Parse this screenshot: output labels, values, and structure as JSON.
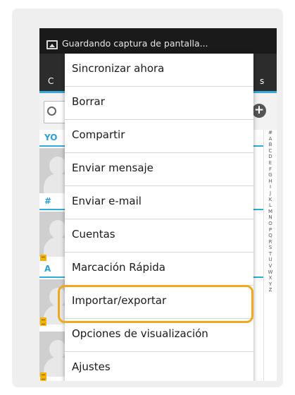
{
  "notification": {
    "text": "Guardando captura de pantalla..."
  },
  "tabs": {
    "left_partial": "C",
    "right_partial": "s"
  },
  "list": {
    "sections": [
      "YO",
      "#",
      "A"
    ]
  },
  "alphabet_index": [
    "#",
    "A",
    "B",
    "C",
    "D",
    "E",
    "F",
    "G",
    "H",
    "I",
    "J",
    "K",
    "L",
    "M",
    "N",
    "O",
    "P",
    "Q",
    "R",
    "S",
    "T",
    "U",
    "V",
    "W",
    "X",
    "Y",
    "Z"
  ],
  "menu": {
    "items": [
      "Sincronizar ahora",
      "Borrar",
      "Compartir",
      "Enviar mensaje",
      "Enviar e-mail",
      "Cuentas",
      "Marcación Rápida",
      "Importar/exportar",
      "Opciones de visualización",
      "Ajustes"
    ],
    "highlighted_item": "Importar/exportar"
  },
  "colors": {
    "accent": "#36a9d8",
    "highlight": "#f0a820",
    "sim_badge": "#f2b200"
  }
}
